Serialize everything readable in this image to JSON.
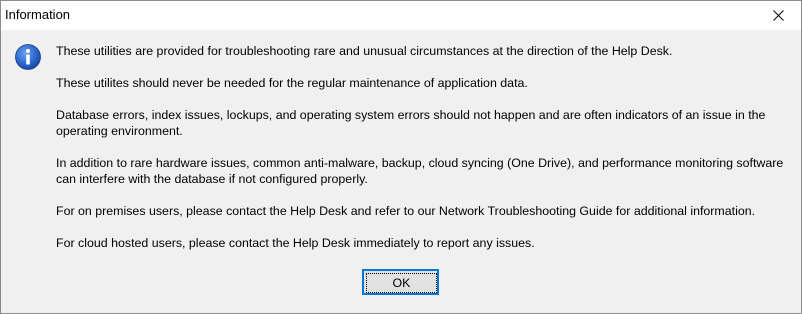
{
  "window": {
    "title": "Information",
    "close_icon": "close-icon"
  },
  "dialog": {
    "icon": "info-icon",
    "icon_color": "#1e5bbf",
    "messages": [
      "These utilities are provided for troubleshooting rare and unusual circumstances at the direction of the Help Desk.",
      "These utilites should never be needed for the regular maintenance of application data.",
      "Database errors, index issues, lockups, and operating system errors should not happen and are often indicators of an issue in the operating environment.",
      "In addition to rare hardware issues, common anti-malware, backup, cloud syncing (One Drive), and performance monitoring software can interfere with the database if not configured properly.",
      "For on premises users, please contact the Help Desk and refer to our Network Troubleshooting Guide for additional information.",
      "For cloud hosted users, please contact the Help Desk immediately to report any issues."
    ],
    "ok_label": "OK"
  },
  "colors": {
    "focus_border": "#0078d7",
    "button_face": "#e1e1e1",
    "dialog_background": "#f0f0f0"
  }
}
